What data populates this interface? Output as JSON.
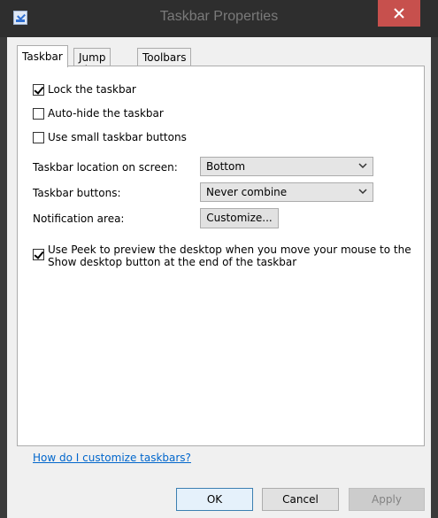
{
  "window": {
    "title": "Taskbar Properties"
  },
  "tabs": [
    {
      "label": "Taskbar"
    },
    {
      "label": "Jump Lists"
    },
    {
      "label": "Toolbars"
    }
  ],
  "options": {
    "lock": {
      "label": "Lock the taskbar",
      "checked": true
    },
    "autohide": {
      "label": "Auto-hide the taskbar",
      "checked": false
    },
    "small": {
      "label": "Use small taskbar buttons",
      "checked": false
    }
  },
  "location": {
    "label": "Taskbar location on screen:",
    "value": "Bottom"
  },
  "buttons": {
    "label": "Taskbar buttons:",
    "value": "Never combine"
  },
  "notification": {
    "label": "Notification area:",
    "button": "Customize..."
  },
  "peek": {
    "checked": true,
    "line1": "Use Peek to preview the desktop when you move your mouse to the",
    "line2": "Show desktop button at the end of the taskbar"
  },
  "help_link": "How do I customize taskbars?",
  "footer": {
    "ok": "OK",
    "cancel": "Cancel",
    "apply": "Apply"
  },
  "colors": {
    "close": "#c7504d",
    "link": "#0066cc",
    "default_button_border": "#3c7fb1"
  }
}
